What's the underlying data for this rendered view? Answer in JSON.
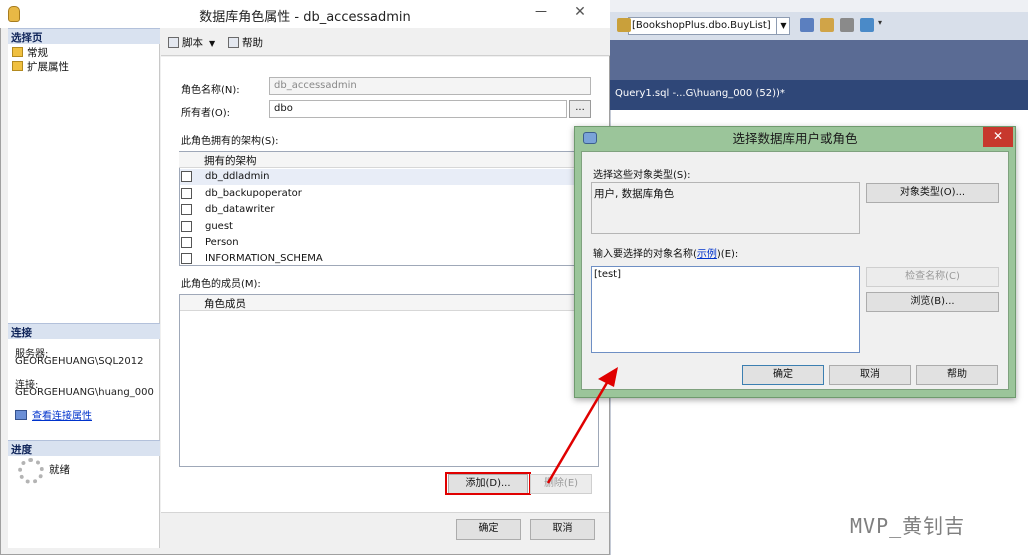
{
  "ssms": {
    "combo_value": "[BookshopPlus.dbo.BuyList]",
    "query_tab": "Query1.sql -...G\\huang_000 (52))*"
  },
  "dialog": {
    "title": "数据库角色属性 - db_accessadmin",
    "minimize": "—",
    "close": "✕"
  },
  "left": {
    "select_page_header": "选择页",
    "pages": [
      "常规",
      "扩展属性"
    ],
    "connection_header": "连接",
    "server_label": "服务器:",
    "server_value": "GEORGEHUANG\\SQL2012",
    "connection_label": "连接:",
    "connection_value": "GEORGEHUANG\\huang_000",
    "view_conn_props": "查看连接属性",
    "progress_header": "进度",
    "status": "就绪"
  },
  "toolbar": {
    "script": "脚本",
    "help": "帮助"
  },
  "general": {
    "role_name_label": "角色名称(N):",
    "role_name_value": "db_accessadmin",
    "owner_label": "所有者(O):",
    "owner_value": "dbo",
    "browse_label": "...",
    "schemas_label": "此角色拥有的架构(S):",
    "schemas_header": "拥有的架构",
    "schemas": [
      "db_ddladmin",
      "db_backupoperator",
      "db_datawriter",
      "guest",
      "Person",
      "INFORMATION_SCHEMA"
    ],
    "members_label": "此角色的成员(M):",
    "members_header": "角色成员",
    "add_button": "添加(D)...",
    "remove_button": "删除(E)"
  },
  "footer": {
    "ok": "确定",
    "cancel": "取消"
  },
  "select_dialog": {
    "title": "选择数据库用户或角色",
    "close": "✕",
    "object_types_label": "选择这些对象类型(S):",
    "object_types_value": "用户, 数据库角色",
    "object_types_button": "对象类型(O)...",
    "enter_names_label": "输入要选择的对象名称(",
    "example_link": "示例",
    "enter_names_suffix": ")(E):",
    "names_value": "[test]",
    "check_names_button": "检查名称(C)",
    "browse_button": "浏览(B)...",
    "ok": "确定",
    "cancel": "取消",
    "help": "帮助"
  },
  "colors": {
    "select_dialog_frame": "#9bc59a",
    "highlight_box": "#e00000",
    "arrow": "#e00000",
    "ssms_tabbar": "#2f4778"
  },
  "watermark": "MVP_黄钊吉"
}
